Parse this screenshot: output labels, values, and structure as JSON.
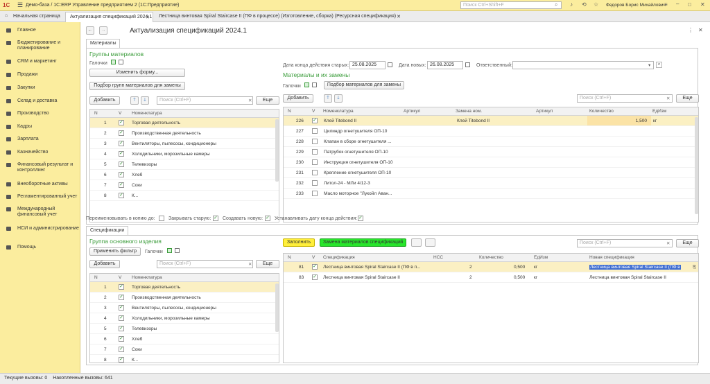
{
  "topbar": {
    "app_title": "Демо-база / 1С:ERP Управление предприятием 2  (1С:Предприятие)",
    "search_placeholder": "Поиск Ctrl+Shift+F",
    "user_name": "Федоров Борис Михайлович"
  },
  "tabs": [
    "Начальная страница",
    "Актуализация спецификаций 2024.1",
    "Лестница винтовая Spiral Staircase II (ПФ в процессе) (Изготовление, сборка) (Ресурсная спецификация)"
  ],
  "sidebar": [
    "Главное",
    "Бюджетирование и планирование",
    "CRM и маркетинг",
    "Продажи",
    "Закупки",
    "Склад и доставка",
    "Производство",
    "Кадры",
    "Зарплата",
    "Казначейство",
    "Финансовый результат и контроллинг",
    "Внеоборотные активы",
    "Регламентированный учет",
    "Международный финансовый учет",
    "НСИ и администрирование",
    "Помощь"
  ],
  "form": {
    "title": "Актуализация спецификаций 2024.1",
    "subtab_materials": "Материалы",
    "subtab_specs": "Спецификации"
  },
  "groups": {
    "title": "Группы материалов",
    "checkmarks": "Галочки",
    "change_form": "Изменить форму...",
    "pick_groups": "Подбор групп материалов для замены",
    "add": "Добавить",
    "search": "Поиск (Ctrl+F)",
    "more": "Еще"
  },
  "dates": {
    "end_old_label": "Дата конца действия старых:",
    "end_old": "25.08.2025",
    "new_label": "Дата новых:",
    "new": "26.08.2025",
    "resp_label": "Ответственный:"
  },
  "materials": {
    "title": "Материалы и их замены",
    "checkmarks": "Галочки",
    "pick": "Подбор материалов для замены",
    "add": "Добавить",
    "search": "Поиск (Ctrl+F)",
    "more": "Еще"
  },
  "nom_table": {
    "cols": [
      "N",
      "V",
      "Номенклатура"
    ],
    "rows": [
      {
        "n": "1",
        "name": "Торговая деятельность"
      },
      {
        "n": "2",
        "name": "Производственная деятельность"
      },
      {
        "n": "3",
        "name": "Вентиляторы, пылесосы, кондиционеры"
      },
      {
        "n": "4",
        "name": "Холодильники, морозильные камеры"
      },
      {
        "n": "5",
        "name": "Телевизоры"
      },
      {
        "n": "6",
        "name": "Хлеб"
      },
      {
        "n": "7",
        "name": "Соки"
      },
      {
        "n": "8",
        "name": "К..."
      }
    ]
  },
  "mat_table": {
    "cols": [
      "N",
      "V",
      "Номенклатура",
      "Артикул",
      "Замена ном.",
      "Артикул",
      "Количество",
      "ЕдИзм"
    ],
    "rows": [
      {
        "n": "226",
        "checked": true,
        "name": "Клей Titebond II",
        "repl": "Клей Titebond II",
        "qty": "1,500",
        "unit": "кг"
      },
      {
        "n": "227",
        "checked": false,
        "name": "Цилиндр огнетушителя ОП-10",
        "repl": "",
        "qty": "",
        "unit": ""
      },
      {
        "n": "228",
        "checked": false,
        "name": "Клапан в сборе огнетушителя ...",
        "repl": "",
        "qty": "",
        "unit": ""
      },
      {
        "n": "229",
        "checked": false,
        "name": "Патрубок огнетушителя ОП-10",
        "repl": "",
        "qty": "",
        "unit": ""
      },
      {
        "n": "230",
        "checked": false,
        "name": "Инструкция огнетушителя ОП-10",
        "repl": "",
        "qty": "",
        "unit": ""
      },
      {
        "n": "231",
        "checked": false,
        "name": "Крепление огнетушителя ОП-10",
        "repl": "",
        "qty": "",
        "unit": ""
      },
      {
        "n": "232",
        "checked": false,
        "name": "Литол-24 - МЛи 4/12-3",
        "repl": "",
        "qty": "",
        "unit": ""
      },
      {
        "n": "233",
        "checked": false,
        "name": "Масло моторное \"Лукойл Аван...",
        "repl": "",
        "qty": "",
        "unit": ""
      }
    ]
  },
  "options": {
    "rename": "Переименовывать в копию до:",
    "close_old": "Закрывать старую:",
    "create_new": "Создавать новую:",
    "set_date": "Устанавливать дату конца действия:"
  },
  "product": {
    "title": "Группа основного изделия",
    "apply_filter": "Применить фильтр",
    "checkmarks": "Галочки",
    "add": "Добавить",
    "search": "Поиск (Ctrl+F)",
    "more": "Еще"
  },
  "spec_toolbar": {
    "fill": "Заполнить",
    "replace": "Замена материалов спецификаций",
    "search": "Поиск (Ctrl+F)",
    "more": "Еще"
  },
  "spec_table": {
    "cols": [
      "N",
      "V",
      "Спецификация",
      "НСС",
      "Количество",
      "ЕдИзм",
      "Новая спецификация"
    ],
    "rows": [
      {
        "n": "81",
        "spec": "Лестница винтовая Spiral Staircase II (ПФ в п...",
        "nss": "2",
        "qty": "0,500",
        "unit": "кг",
        "new": "Лестница винтовая Spiral Staircase II (ПФ в"
      },
      {
        "n": "83",
        "spec": "Лестница винтовая Spiral Staircase II",
        "nss": "2",
        "qty": "0,500",
        "unit": "кг",
        "new": "Лестница винтовая Spiral Staircase II"
      }
    ]
  },
  "status": {
    "current": "Текущие вызовы: 0",
    "accum": "Накопленные вызовы: 641"
  }
}
